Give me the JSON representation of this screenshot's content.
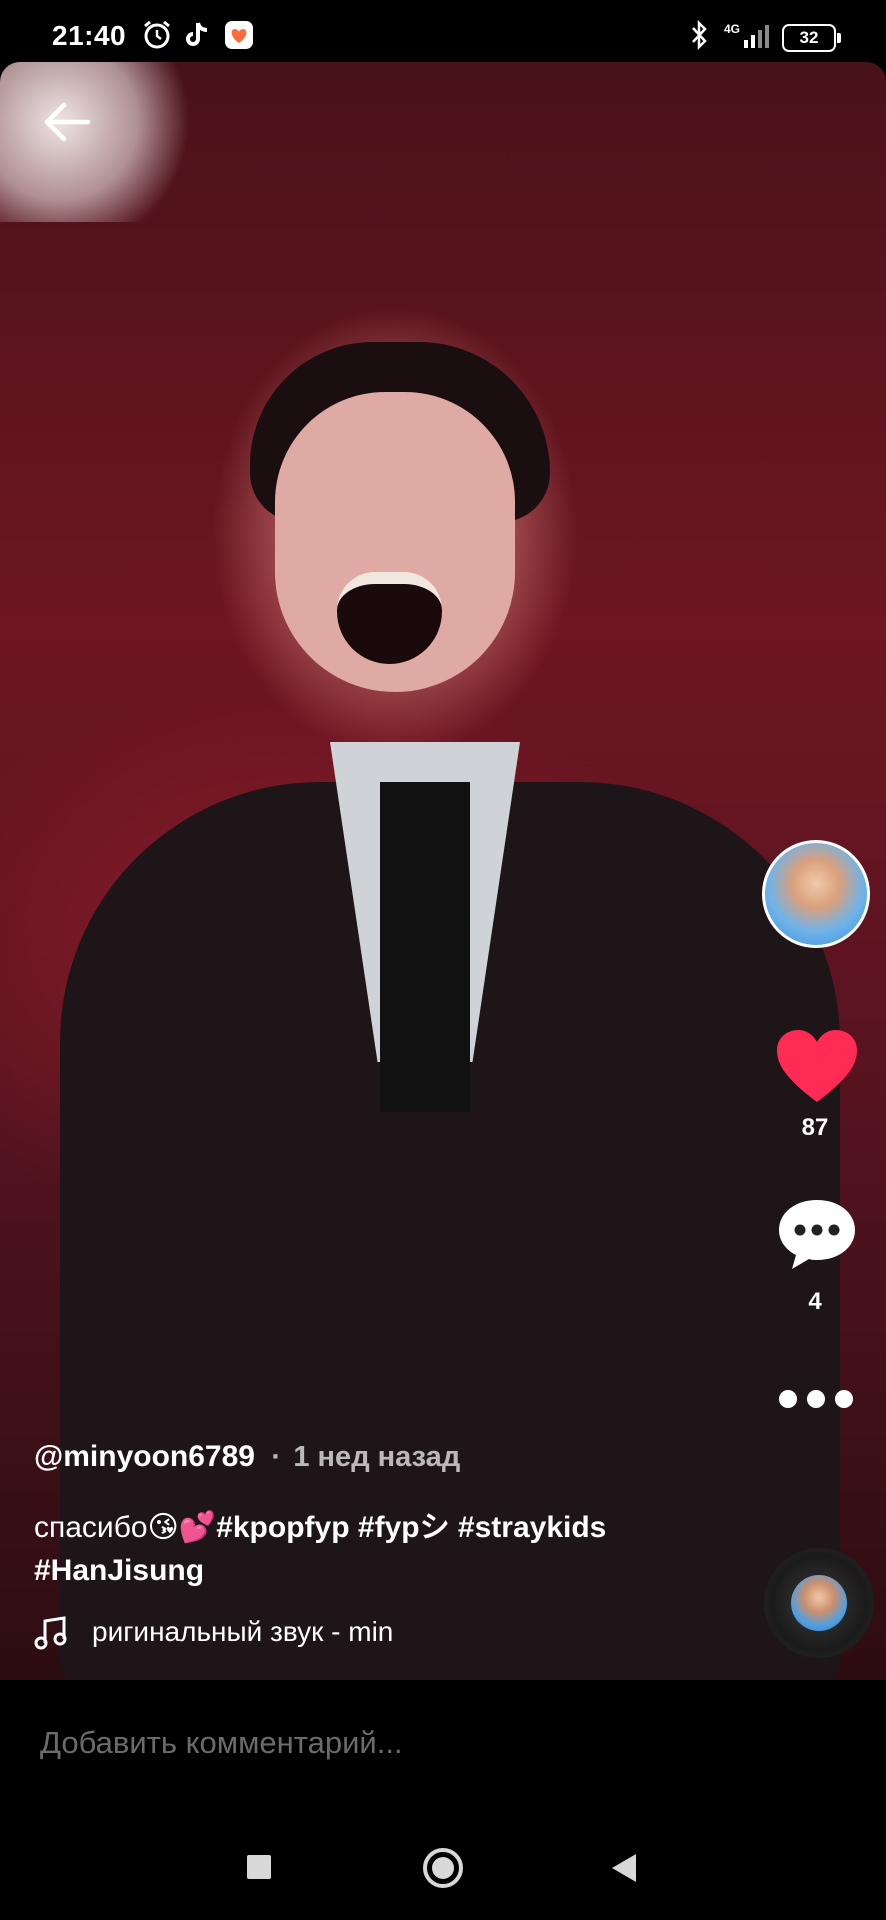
{
  "status_bar": {
    "time": "21:40",
    "network": "4G",
    "battery": "32",
    "icons": [
      "alarm-icon",
      "tiktok-icon",
      "gallery-app-icon",
      "bluetooth-icon",
      "signal-icon",
      "battery-icon"
    ]
  },
  "video": {
    "back_icon": "arrow-left-icon"
  },
  "actions": {
    "likes": "87",
    "comments": "4",
    "like_color": "#fe2c55"
  },
  "post": {
    "username": "@minyoon6789",
    "separator": "·",
    "time_ago": "1 нед назад",
    "caption_text": "спасибо😘💕",
    "hashtags": [
      "#kpopfyp",
      "#fypシ",
      "#straykids",
      "#HanJisung"
    ],
    "sound": "ригинальный звук - min"
  },
  "comment_bar": {
    "placeholder": "Добавить комментарий..."
  },
  "nav_bar": {
    "icons": [
      "recents-square-icon",
      "home-circle-icon",
      "back-triangle-icon"
    ]
  }
}
